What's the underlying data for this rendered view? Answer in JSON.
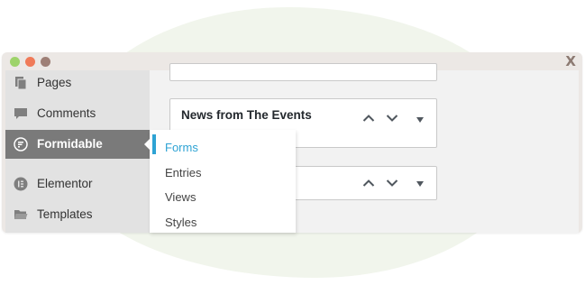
{
  "window": {
    "close_label": "X"
  },
  "sidebar": {
    "items": [
      {
        "label": "Pages",
        "icon": "pages-icon"
      },
      {
        "label": "Comments",
        "icon": "comments-icon"
      },
      {
        "label": "Formidable",
        "icon": "formidable-icon",
        "active": true
      },
      {
        "label": "Elementor",
        "icon": "elementor-icon"
      },
      {
        "label": "Templates",
        "icon": "folder-icon"
      }
    ]
  },
  "submenu": {
    "items": [
      {
        "label": "Forms",
        "current": true
      },
      {
        "label": "Entries"
      },
      {
        "label": "Views"
      },
      {
        "label": "Styles"
      }
    ]
  },
  "main": {
    "widgets": [
      {
        "title": "News from The Events"
      }
    ]
  },
  "colors": {
    "accent": "#2ea3d4",
    "active_menu_bg": "#7a7a7a",
    "window_bg": "#ece8e5"
  }
}
